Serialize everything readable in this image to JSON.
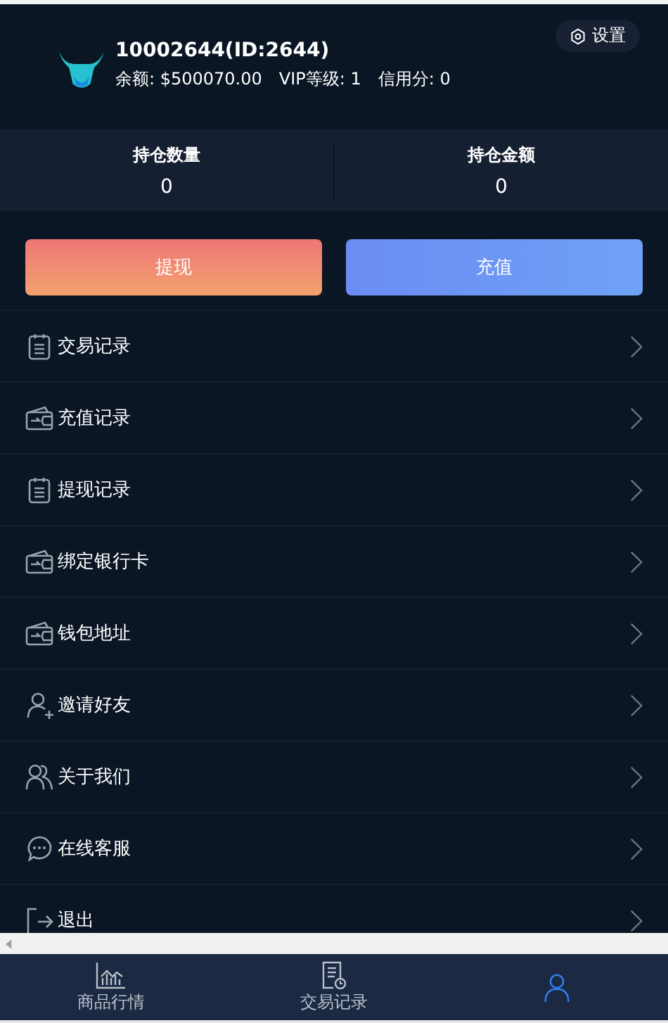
{
  "profile": {
    "name": "10002644(ID:2644)",
    "balance_label": "余额:",
    "balance": "$500070.00",
    "vip_label": "VIP等级:",
    "vip": "1",
    "credit_label": "信用分:",
    "credit": "0"
  },
  "settings_button": {
    "label": "设置"
  },
  "stats": [
    {
      "label": "持仓数量",
      "value": "0"
    },
    {
      "label": "持仓金额",
      "value": "0"
    }
  ],
  "actions": [
    {
      "label": "提现",
      "kind": "withdraw"
    },
    {
      "label": "充值",
      "kind": "deposit"
    }
  ],
  "menu": [
    {
      "label": "交易记录",
      "kind": "doc"
    },
    {
      "label": "充值记录",
      "kind": "wallet"
    },
    {
      "label": "提现记录",
      "kind": "doc"
    },
    {
      "label": "绑定银行卡",
      "kind": "wallet"
    },
    {
      "label": "钱包地址",
      "kind": "wallet"
    },
    {
      "label": "邀请好友",
      "kind": "user-plus"
    },
    {
      "label": "关于我们",
      "kind": "users"
    },
    {
      "label": "在线客服",
      "kind": "chat"
    },
    {
      "label": "退出",
      "kind": "logout"
    }
  ],
  "bottom_nav": [
    {
      "label": "商品行情",
      "kind": "chart",
      "selected": false
    },
    {
      "label": "交易记录",
      "kind": "receipt",
      "selected": false
    },
    {
      "kind": "person",
      "selected": true
    }
  ]
}
